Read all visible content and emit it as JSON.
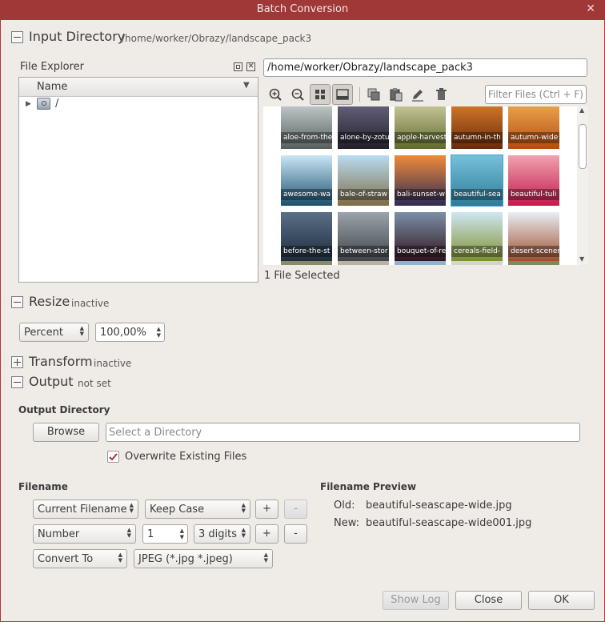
{
  "window": {
    "title": "Batch Conversion",
    "close_glyph": "✕"
  },
  "input_directory": {
    "title": "Input Directory",
    "path": "/home/worker/Obrazy/landscape_pack3",
    "file_explorer_label": "File Explorer",
    "tree_header": "Name",
    "tree_root": "/",
    "path_field": "/home/worker/Obrazy/landscape_pack3",
    "filter_placeholder": "Filter Files (Ctrl + F)",
    "selection_status": "1 File Selected",
    "thumbnails": [
      {
        "label": "aloe-from-the",
        "c1": "#cfd7d8",
        "c2": "#55605e"
      },
      {
        "label": "alone-by-zotu",
        "c1": "#6b6a85",
        "c2": "#231f2a"
      },
      {
        "label": "apple-harvest",
        "c1": "#d7d2a8",
        "c2": "#5f6b2c"
      },
      {
        "label": "autumn-in-th",
        "c1": "#e0822c",
        "c2": "#6a2a0c"
      },
      {
        "label": "autumn-wide",
        "c1": "#f2b152",
        "c2": "#b64b14"
      },
      {
        "label": "awesome-wa",
        "c1": "#c9e6f6",
        "c2": "#1b4f6e"
      },
      {
        "label": "bale-of-straw",
        "c1": "#b9dcf1",
        "c2": "#7f6b46"
      },
      {
        "label": "bali-sunset-w",
        "c1": "#f08a3a",
        "c2": "#2c2b55"
      },
      {
        "label": "beautiful-sea",
        "c1": "#8ed4dc",
        "c2": "#1e6a78"
      },
      {
        "label": "beautiful-tuli",
        "c1": "#f1a1b0",
        "c2": "#c21a4a"
      },
      {
        "label": "before-the-st",
        "c1": "#5a6f88",
        "c2": "#1d2a3a"
      },
      {
        "label": "between-stor",
        "c1": "#9aa3aa",
        "c2": "#3d4247"
      },
      {
        "label": "bouquet-of-re",
        "c1": "#7b8fa6",
        "c2": "#30101a"
      },
      {
        "label": "cereals-field-",
        "c1": "#cfe6f2",
        "c2": "#7a8d2a"
      },
      {
        "label": "desert-scener",
        "c1": "#e9eef2",
        "c2": "#9b4a2a"
      }
    ]
  },
  "resize": {
    "title": "Resize",
    "status": "inactive",
    "unit": "Percent",
    "value": "100,00%"
  },
  "transform": {
    "title": "Transform",
    "status": "inactive"
  },
  "output": {
    "title": "Output",
    "status": "not set",
    "dir_label": "Output Directory",
    "browse": "Browse",
    "dir_placeholder": "Select a Directory",
    "overwrite_label": "Overwrite Existing Files",
    "overwrite_checked": true
  },
  "filename": {
    "label": "Filename",
    "row1": {
      "source": "Current Filename",
      "case": "Keep Case",
      "add": "+",
      "remove": "-"
    },
    "row2": {
      "type": "Number",
      "start": "1",
      "digits": "3 digits",
      "add": "+",
      "remove": "-"
    },
    "row3": {
      "mode": "Convert To",
      "format": "JPEG (*.jpg *.jpeg)"
    }
  },
  "preview": {
    "label": "Filename Preview",
    "old_label": "Old:",
    "old_value": "beautiful-seascape-wide.jpg",
    "new_label": "New:",
    "new_value": "beautiful-seascape-wide001.jpg"
  },
  "buttons": {
    "show_log": "Show Log",
    "close": "Close",
    "ok": "OK"
  },
  "colors": {
    "titlebar": "#a03838",
    "window_bg": "#efebe7",
    "selection": "#4a9fd8",
    "check": "#b03030"
  }
}
